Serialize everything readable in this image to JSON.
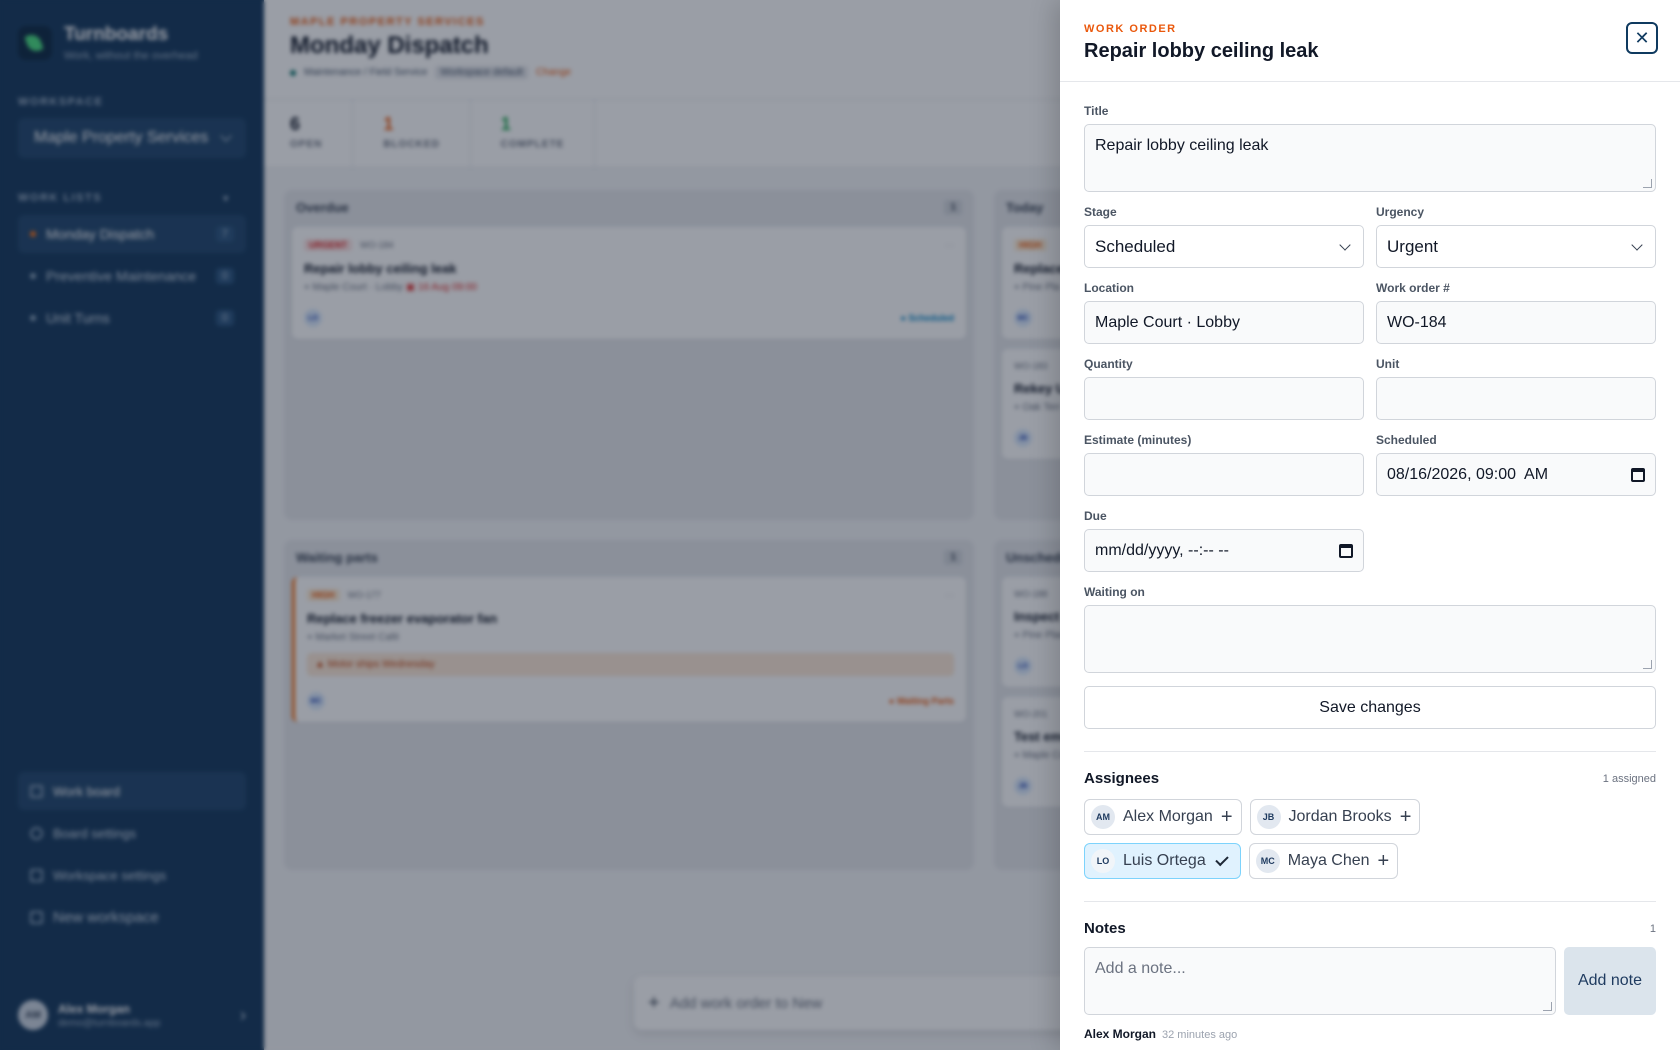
{
  "sidebar": {
    "brand_name": "Turnboards",
    "brand_tagline": "Work, without the overhead",
    "workspace_label": "WORKSPACE",
    "workspace_value": "Maple Property Services",
    "worklists_label": "WORK LISTS",
    "worklists": [
      {
        "label": "Monday Dispatch",
        "count": "7"
      },
      {
        "label": "Preventive Maintenance",
        "count": "0"
      },
      {
        "label": "Unit Turns",
        "count": "0"
      }
    ],
    "bottom_items": [
      "Work board",
      "Board settings",
      "Workspace settings",
      "New workspace"
    ],
    "user_name": "Alex Morgan",
    "user_email": "demo@turnboards.app",
    "user_initials": "AM"
  },
  "main": {
    "eyebrow": "MAPLE PROPERTY SERVICES",
    "title": "Monday Dispatch",
    "meta_path": "Maintenance / Field Service",
    "meta_badge": "Workspace default",
    "meta_change": "Change",
    "stats": [
      {
        "num": "6",
        "label": "OPEN"
      },
      {
        "num": "1",
        "label": "BLOCKED"
      },
      {
        "num": "1",
        "label": "COMPLETE"
      }
    ],
    "columns": {
      "overdue": {
        "title": "Overdue",
        "count": "1"
      },
      "today": {
        "title": "Today"
      },
      "waiting": {
        "title": "Waiting parts",
        "count": "1"
      },
      "unscheduled": {
        "title": "Unschedul"
      }
    },
    "cards": {
      "c184": {
        "tag": "URGENT",
        "id": "WO-184",
        "title": "Repair lobby ceiling leak",
        "location": "Maple Court · Lobby",
        "date": "16 Aug 09:00",
        "avatar": "LO",
        "status": "● Scheduled"
      },
      "c177": {
        "tag": "HIGH",
        "id": "WO-177",
        "title": "Replace freezer evaporator fan",
        "location": "Market Street Café",
        "warn": "Motor ships Wednesday",
        "avatar": "MC",
        "status": "● Waiting Parts"
      },
      "t1": {
        "tag": "HIGH",
        "title": "Replace r",
        "location": "Pine Pla",
        "avatar": "MC"
      },
      "t2": {
        "id": "WO-183",
        "title": "Rekey Un",
        "location": "Oak Terr",
        "avatar": "JB"
      },
      "u1": {
        "id": "WO-188",
        "title": "Inspect la",
        "location": "Pine Plac",
        "avatar": "LO"
      },
      "u2": {
        "id": "WO-201",
        "title": "Test emer",
        "location": "Maple Co",
        "avatar": "JB"
      }
    },
    "add_bar": "Add work order to New"
  },
  "drawer": {
    "eyebrow": "WORK ORDER",
    "title": "Repair lobby ceiling leak",
    "fields": {
      "title_label": "Title",
      "title_value": "Repair lobby ceiling leak",
      "stage_label": "Stage",
      "stage_value": "Scheduled",
      "urgency_label": "Urgency",
      "urgency_value": "Urgent",
      "location_label": "Location",
      "location_value": "Maple Court · Lobby",
      "wo_label": "Work order #",
      "wo_value": "WO-184",
      "quantity_label": "Quantity",
      "unit_label": "Unit",
      "estimate_label": "Estimate (minutes)",
      "scheduled_label": "Scheduled",
      "scheduled_value": "08/16/2026, 09:00  AM",
      "due_label": "Due",
      "due_placeholder": "mm/dd/yyyy, --:-- --",
      "waiting_label": "Waiting on"
    },
    "save_label": "Save changes",
    "assignees_title": "Assignees",
    "assignees_meta": "1 assigned",
    "assignees": [
      {
        "initials": "AM",
        "name": "Alex Morgan",
        "assigned": false
      },
      {
        "initials": "JB",
        "name": "Jordan Brooks",
        "assigned": false
      },
      {
        "initials": "LO",
        "name": "Luis Ortega",
        "assigned": true
      },
      {
        "initials": "MC",
        "name": "Maya Chen",
        "assigned": false
      }
    ],
    "notes_title": "Notes",
    "notes_count": "1",
    "note_placeholder": "Add a note...",
    "add_note_label": "Add note",
    "note_author": "Alex Morgan",
    "note_time": "32 minutes ago"
  }
}
